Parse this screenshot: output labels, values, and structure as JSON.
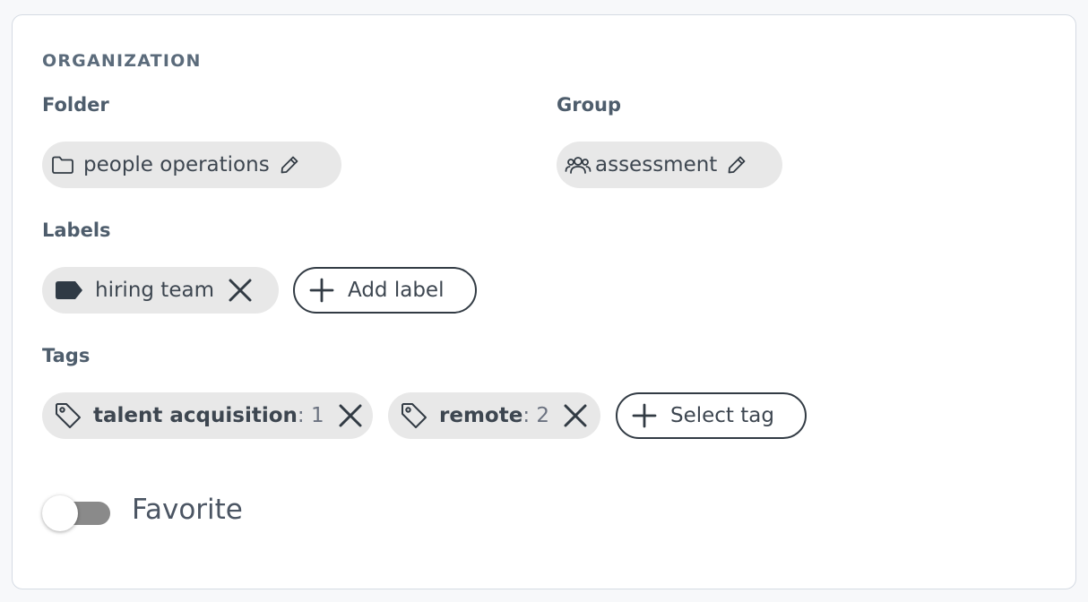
{
  "section": {
    "title": "ORGANIZATION"
  },
  "folder": {
    "label": "Folder",
    "value": "people operations",
    "icon": "folder-icon",
    "edit_icon": "pencil-icon"
  },
  "group": {
    "label": "Group",
    "value": "assessment",
    "icon": "users-icon",
    "edit_icon": "pencil-icon"
  },
  "labels": {
    "label": "Labels",
    "items": [
      {
        "name": "hiring team",
        "color": "#2f3a45"
      }
    ],
    "add_button": "Add label"
  },
  "tags": {
    "label": "Tags",
    "items": [
      {
        "name": "talent acquisition",
        "count": ": 1"
      },
      {
        "name": "remote",
        "count": ": 2"
      }
    ],
    "add_button": "Select tag"
  },
  "favorite": {
    "label": "Favorite",
    "enabled": false
  },
  "colors": {
    "chip_bg": "#e8e8e8",
    "text": "#3d4650",
    "heading": "#4e5d6c",
    "toggle_track": "#8a8a8a"
  }
}
